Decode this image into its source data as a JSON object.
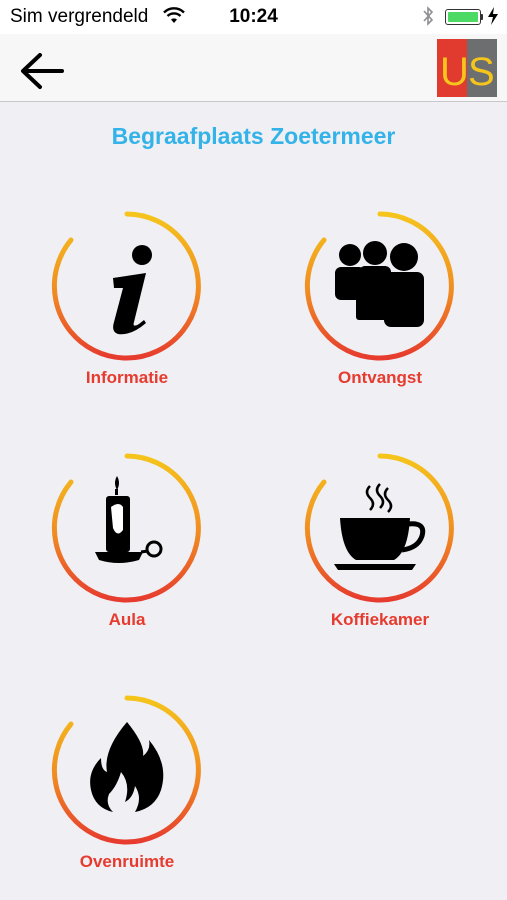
{
  "status_bar": {
    "carrier": "Sim vergrendeld",
    "time": "10:24"
  },
  "header": {
    "logo_text": "US",
    "logo_colors": {
      "left": "#e03b2e",
      "right": "#6d6e70",
      "text": "#f5c51c"
    }
  },
  "page": {
    "title": "Begraafplaats Zoetermeer"
  },
  "tiles": [
    {
      "label": "Informatie",
      "icon": "info-icon"
    },
    {
      "label": "Ontvangst",
      "icon": "group-icon"
    },
    {
      "label": "Aula",
      "icon": "candle-icon"
    },
    {
      "label": "Koffiekamer",
      "icon": "coffee-cup-icon"
    },
    {
      "label": "Ovenruimte",
      "icon": "flame-icon"
    }
  ],
  "colors": {
    "title": "#34b3e8",
    "label": "#e63b2e",
    "ring_start": "#f5c51c",
    "ring_end": "#e63b2e"
  }
}
